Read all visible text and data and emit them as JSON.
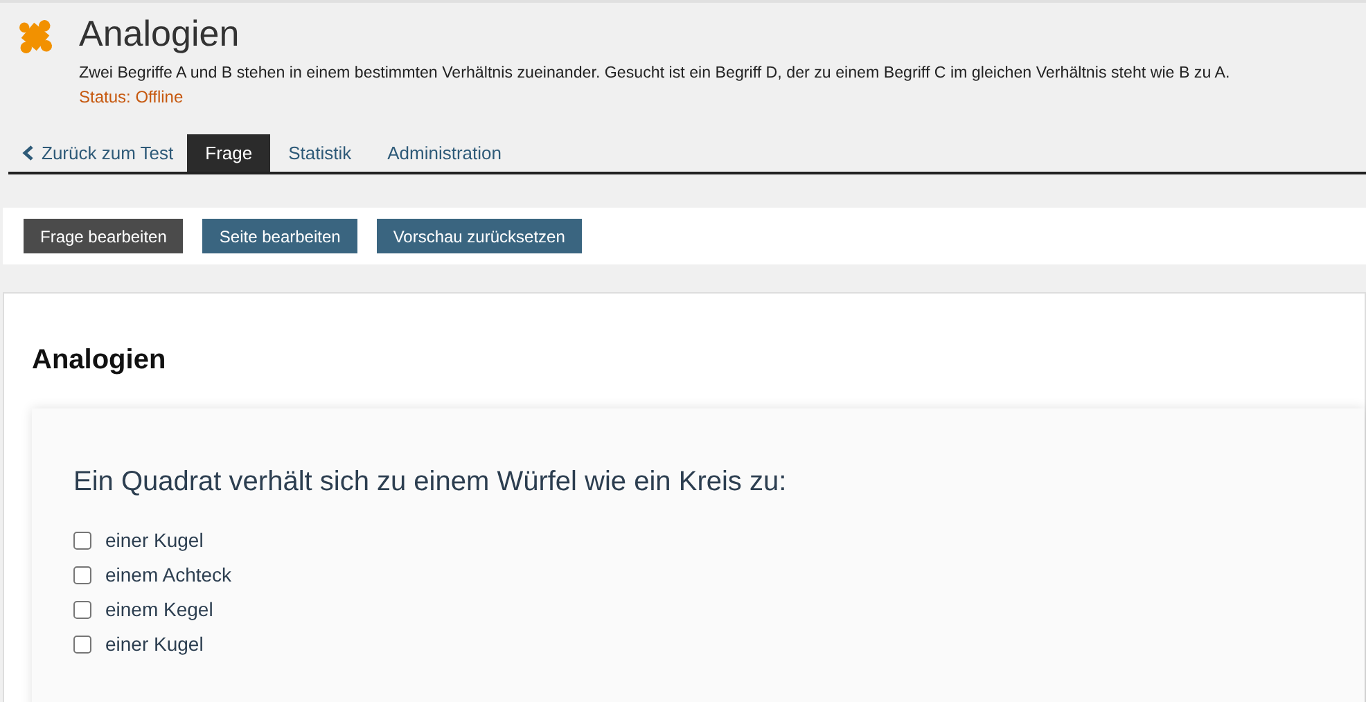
{
  "header": {
    "title": "Analogien",
    "description": "Zwei Begriffe A und B stehen in einem bestimmten Verhältnis zueinander. Gesucht ist ein Begriff D, der zu einem Begriff C im gleichen Verhältnis steht wie B zu A.",
    "status": "Status: Offline"
  },
  "tabs": [
    {
      "label": "Zurück zum Test",
      "kind": "back"
    },
    {
      "label": "Frage",
      "kind": "tab",
      "selected": true
    },
    {
      "label": "Statistik",
      "kind": "tab",
      "selected": false
    },
    {
      "label": "Administration",
      "kind": "tab",
      "selected": false
    }
  ],
  "toolbar": [
    {
      "label": "Frage bearbeiten",
      "kind": "dark"
    },
    {
      "label": "Seite bearbeiten",
      "kind": "accent"
    },
    {
      "label": "Vorschau zurücksetzen",
      "kind": "accent"
    }
  ],
  "card": {
    "title": "Analogien",
    "question": "Ein Quadrat verhält sich zu einem Würfel wie ein Kreis zu:",
    "options": [
      {
        "label": "einer Kugel",
        "checked": false
      },
      {
        "label": "einem Achteck",
        "checked": false
      },
      {
        "label": "einem Kegel",
        "checked": false
      },
      {
        "label": "einer Kugel",
        "checked": false
      }
    ]
  }
}
